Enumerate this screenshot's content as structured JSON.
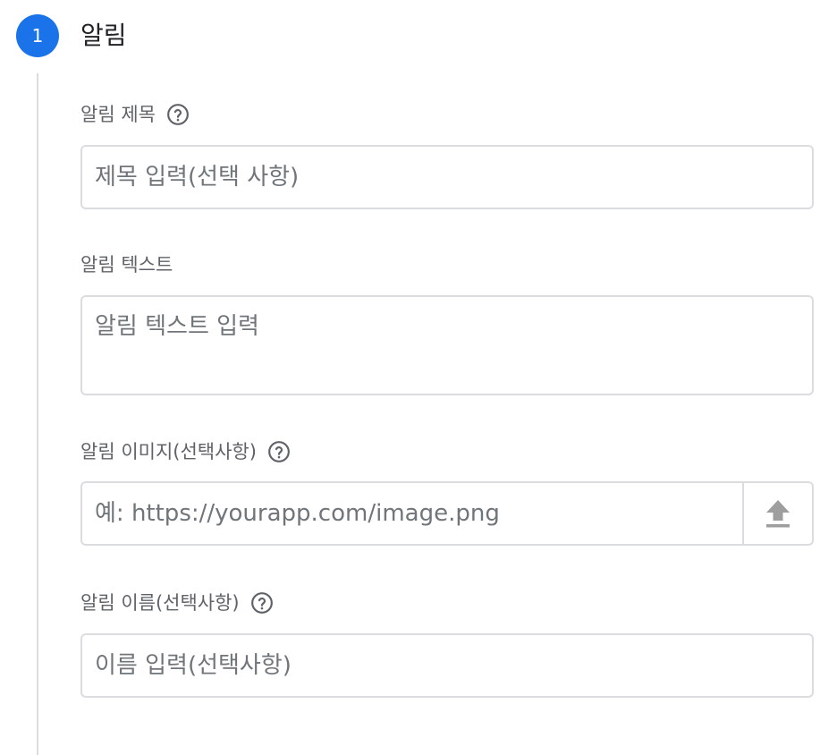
{
  "step": {
    "number": "1",
    "title": "알림"
  },
  "fields": {
    "title": {
      "label": "알림 제목",
      "placeholder": "제목 입력(선택 사항)"
    },
    "text": {
      "label": "알림 텍스트",
      "placeholder": "알림 텍스트 입력"
    },
    "image": {
      "label": "알림 이미지(선택사항)",
      "placeholder": "예: https://yourapp.com/image.png"
    },
    "name": {
      "label": "알림 이름(선택사항)",
      "placeholder": "이름 입력(선택사항)"
    }
  },
  "icons": {
    "help": "help-circle-icon",
    "upload": "upload-icon"
  },
  "colors": {
    "accent": "#1a73e8",
    "border": "#dadce0",
    "label": "#5f6368",
    "icon": "#757575"
  }
}
